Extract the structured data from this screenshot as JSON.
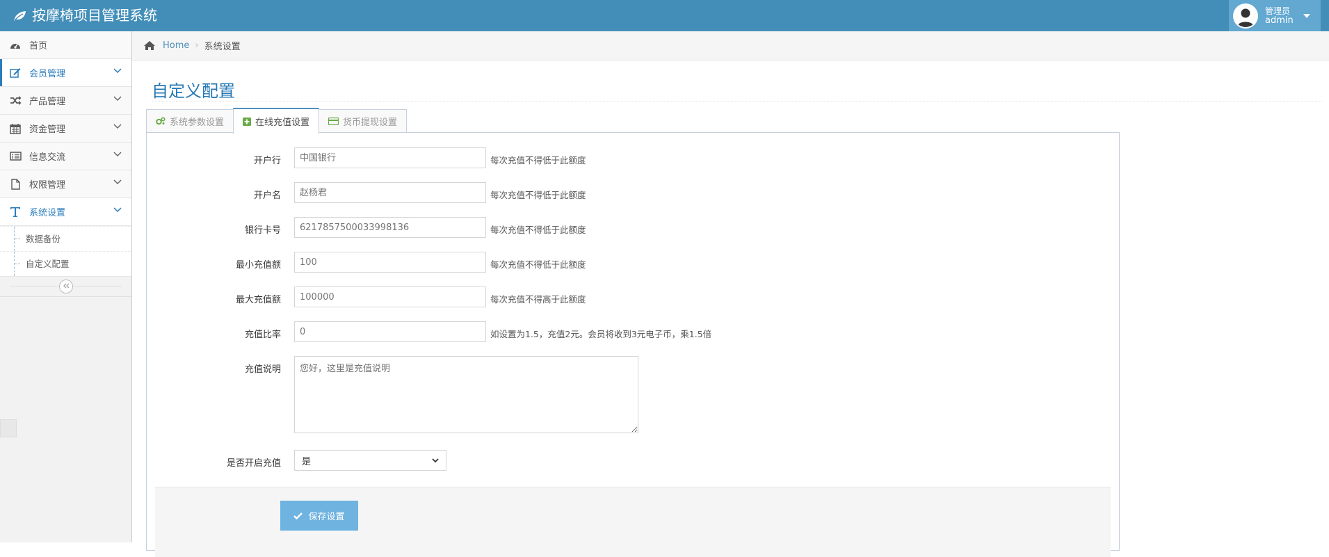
{
  "app": {
    "title": "按摩椅项目管理系统",
    "brand_icon": "leaf-icon"
  },
  "user": {
    "role": "管理员",
    "name": "admin"
  },
  "sidebar": {
    "items": [
      {
        "label": "首页",
        "icon": "dashboard-icon"
      },
      {
        "label": "会员管理",
        "icon": "edit-icon"
      },
      {
        "label": "产品管理",
        "icon": "random-icon"
      },
      {
        "label": "资金管理",
        "icon": "calendar-icon"
      },
      {
        "label": "信息交流",
        "icon": "list-icon"
      },
      {
        "label": "权限管理",
        "icon": "file-icon"
      },
      {
        "label": "系统设置",
        "icon": "text-icon"
      }
    ],
    "submenu": [
      {
        "label": "数据备份"
      },
      {
        "label": "自定义配置"
      }
    ]
  },
  "breadcrumb": {
    "home": "Home",
    "current": "系统设置"
  },
  "page": {
    "title": "自定义配置"
  },
  "tabs": [
    {
      "label": "系统参数设置",
      "icon": "cogs-icon"
    },
    {
      "label": "在线充值设置",
      "icon": "plus-square-icon"
    },
    {
      "label": "货币提现设置",
      "icon": "credit-card-icon"
    }
  ],
  "form": {
    "bank": {
      "label": "开户行",
      "placeholder": "中国银行",
      "help": "每次充值不得低于此额度"
    },
    "account_name": {
      "label": "开户名",
      "placeholder": "赵杨君",
      "help": "每次充值不得低于此额度"
    },
    "card_no": {
      "label": "银行卡号",
      "placeholder": "6217857500033998136",
      "help": "每次充值不得低于此额度"
    },
    "min_amount": {
      "label": "最小充值额",
      "placeholder": "100",
      "help": "每次充值不得低于此额度"
    },
    "max_amount": {
      "label": "最大充值额",
      "placeholder": "100000",
      "help": "每次充值不得高于此额度"
    },
    "ratio": {
      "label": "充值比率",
      "placeholder": "0",
      "help": "如设置为1.5，充值2元。会员将收到3元电子币，乘1.5倍"
    },
    "description": {
      "label": "充值说明",
      "placeholder": "您好，这里是充值说明"
    },
    "enabled": {
      "label": "是否开启充值",
      "value": "是"
    },
    "save_label": "保存设置"
  },
  "colors": {
    "navbar": "#438eb9",
    "accent": "#2679b5",
    "button": "#6fb3e0"
  }
}
